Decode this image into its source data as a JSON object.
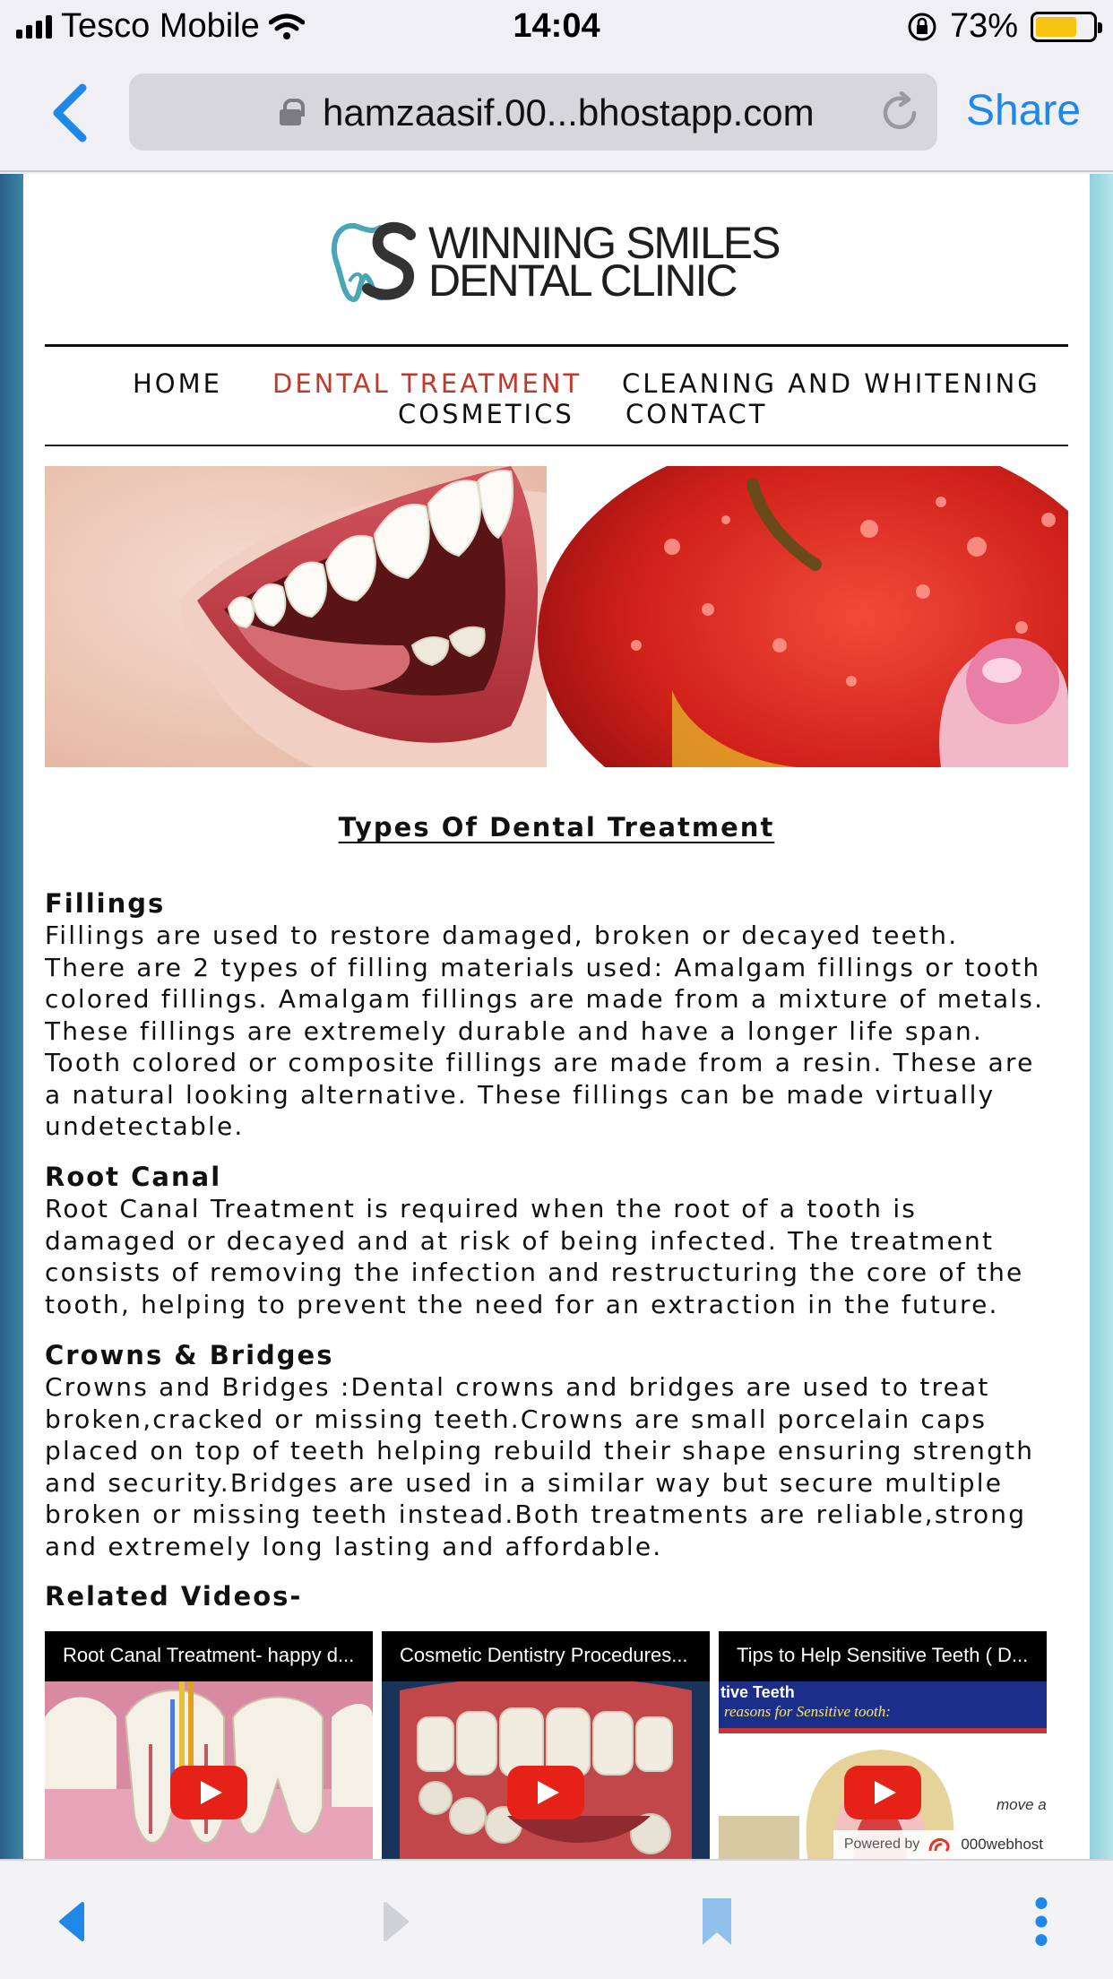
{
  "status_bar": {
    "carrier": "Tesco Mobile",
    "time": "14:04",
    "battery_percent": "73%",
    "battery_level": 0.73,
    "battery_color": "#f6c310"
  },
  "browser": {
    "address": "hamzaasif.00...bhostapp.com",
    "share_label": "Share",
    "accent_color": "#1f87e8"
  },
  "site": {
    "logo_line1": "WINNING SMILES",
    "logo_line2": "DENTAL CLINIC",
    "nav": [
      {
        "label": "HOME",
        "active": false
      },
      {
        "label": "DENTAL TREATMENT",
        "active": true
      },
      {
        "label": "CLEANING AND WHITENING",
        "active": false
      },
      {
        "label": "COSMETICS",
        "active": false
      },
      {
        "label": "CONTACT",
        "active": false
      }
    ],
    "active_nav_color": "#c0392b"
  },
  "main": {
    "section_title": "Types Of Dental Treatment",
    "treatments": [
      {
        "title": "Fillings",
        "lines": [
          "Fillings are used to restore damaged, broken or decayed teeth.",
          "There are 2 types of filling materials used: Amalgam fillings or tooth",
          "colored fillings. Amalgam fillings are made from a mixture of metals.",
          "These fillings are extremely durable and have a longer life span.",
          "Tooth colored or composite fillings are made from a resin. These are",
          "a natural looking alternative. These fillings can be made virtually",
          "undetectable."
        ]
      },
      {
        "title": "Root Canal",
        "lines": [
          "Root Canal Treatment is required when the root of a tooth is",
          "damaged or decayed and at risk of being infected. The treatment",
          "consists of removing the infection and restructuring the core of the",
          "tooth, helping to prevent the need for an extraction in the future."
        ]
      },
      {
        "title": "Crowns & Bridges",
        "lines": [
          "Crowns and Bridges :Dental crowns and bridges are used to treat",
          "broken,cracked or missing teeth.Crowns are small porcelain caps",
          "placed on top of teeth helping rebuild their shape ensuring strength",
          "and security.Bridges are used in a similar way but secure multiple",
          "broken or missing teeth instead.Both treatments are reliable,strong",
          "and extremely long lasting and affordable."
        ]
      }
    ],
    "related_label": "Related Videos-",
    "videos": [
      {
        "title": "Root Canal Treatment- happy d..."
      },
      {
        "title": "Cosmetic Dentistry Procedures..."
      },
      {
        "title": "Tips to Help Sensitive Teeth ( D...",
        "thumb_line1": "tive Teeth",
        "thumb_line2": "reasons for Sensitive tooth:",
        "thumb_line3": "move a"
      }
    ],
    "powered_by": "Powered by",
    "powered_brand": "000webhost"
  }
}
